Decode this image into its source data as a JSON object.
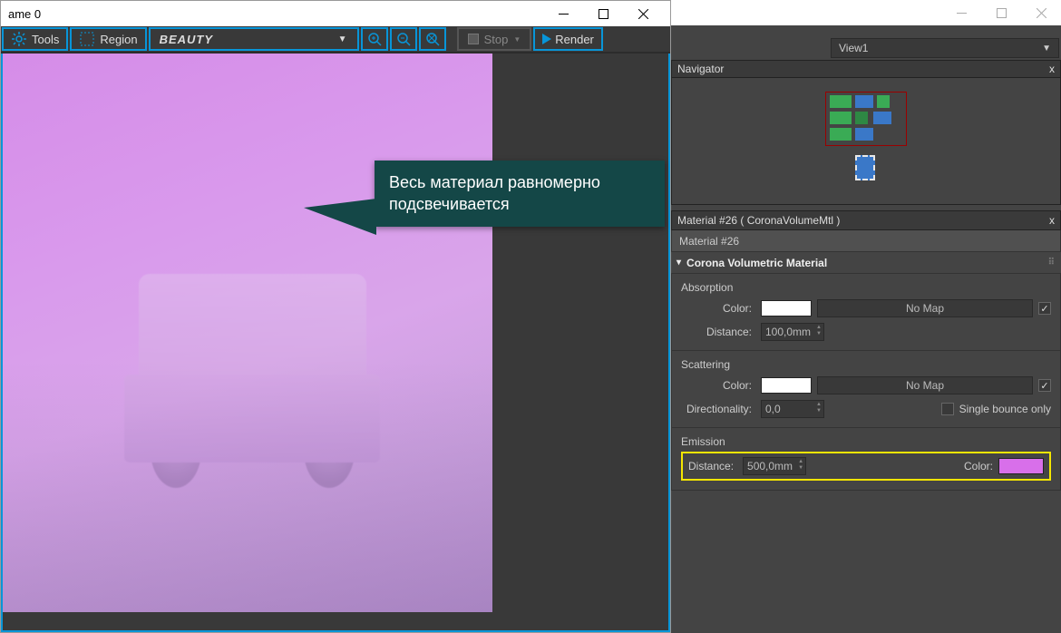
{
  "vfb": {
    "title": "ame 0",
    "tools": "Tools",
    "region": "Region",
    "beauty": "BEAUTY",
    "stop": "Stop",
    "render": "Render"
  },
  "callout": {
    "line1": "Весь материал равномерно",
    "line2": "подсвечивается"
  },
  "right_view": {
    "label": "View1"
  },
  "navigator": {
    "title": "Navigator"
  },
  "material": {
    "header": "Material #26  ( CoronaVolumeMtl )",
    "name": "Material #26",
    "rollout": "Corona Volumetric Material",
    "absorption": {
      "title": "Absorption",
      "color_label": "Color:",
      "color": "#ffffff",
      "nomap": "No Map",
      "distance_label": "Distance:",
      "distance": "100,0mm"
    },
    "scattering": {
      "title": "Scattering",
      "color_label": "Color:",
      "color": "#ffffff",
      "nomap": "No Map",
      "dir_label": "Directionality:",
      "dir": "0,0",
      "single": "Single bounce only"
    },
    "emission": {
      "title": "Emission",
      "distance_label": "Distance:",
      "distance": "500,0mm",
      "color_label": "Color:",
      "color": "#d86fea"
    }
  }
}
